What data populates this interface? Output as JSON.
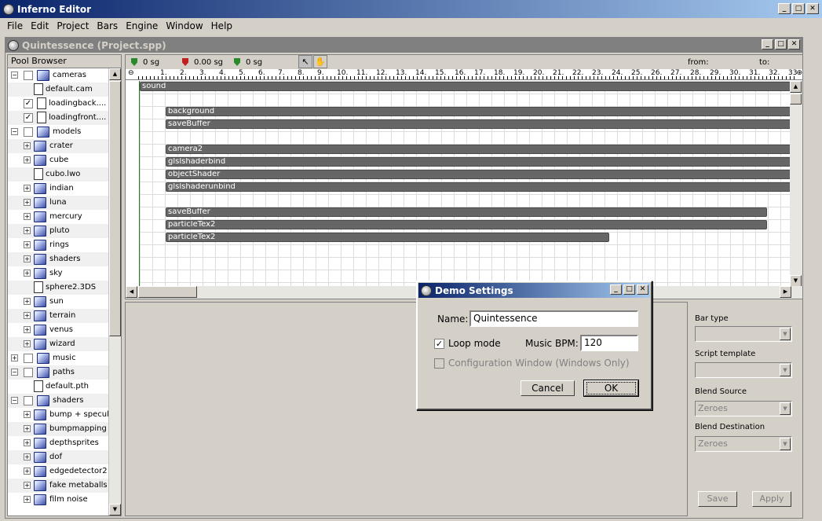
{
  "app": {
    "title": "Inferno Editor"
  },
  "menu": [
    "File",
    "Edit",
    "Project",
    "Bars",
    "Engine",
    "Window",
    "Help"
  ],
  "project_window": {
    "title": "Quintessence (Project.spp)"
  },
  "pool": {
    "header": "Pool Browser",
    "items": [
      {
        "label": "cameras",
        "type": "folder",
        "level": 0,
        "expander": "−",
        "checkbox": "unchecked"
      },
      {
        "label": "default.cam",
        "type": "file",
        "level": 1,
        "expander": "",
        "checkbox": "none"
      },
      {
        "label": "loadingback....",
        "type": "file",
        "level": 1,
        "expander": "",
        "checkbox": "checked"
      },
      {
        "label": "loadingfront....",
        "type": "file",
        "level": 1,
        "expander": "",
        "checkbox": "checked"
      },
      {
        "label": "models",
        "type": "folder",
        "level": 0,
        "expander": "−",
        "checkbox": "unchecked"
      },
      {
        "label": "crater",
        "type": "folder",
        "level": 1,
        "expander": "+",
        "checkbox": "none"
      },
      {
        "label": "cube",
        "type": "folder",
        "level": 1,
        "expander": "+",
        "checkbox": "none"
      },
      {
        "label": "cubo.lwo",
        "type": "file",
        "level": 1,
        "expander": "",
        "checkbox": "none"
      },
      {
        "label": "indian",
        "type": "folder",
        "level": 1,
        "expander": "+",
        "checkbox": "none"
      },
      {
        "label": "luna",
        "type": "folder",
        "level": 1,
        "expander": "+",
        "checkbox": "none"
      },
      {
        "label": "mercury",
        "type": "folder",
        "level": 1,
        "expander": "+",
        "checkbox": "none"
      },
      {
        "label": "pluto",
        "type": "folder",
        "level": 1,
        "expander": "+",
        "checkbox": "none"
      },
      {
        "label": "rings",
        "type": "folder",
        "level": 1,
        "expander": "+",
        "checkbox": "none"
      },
      {
        "label": "shaders",
        "type": "folder",
        "level": 1,
        "expander": "+",
        "checkbox": "none"
      },
      {
        "label": "sky",
        "type": "folder",
        "level": 1,
        "expander": "+",
        "checkbox": "none"
      },
      {
        "label": "sphere2.3DS",
        "type": "file",
        "level": 1,
        "expander": "",
        "checkbox": "none"
      },
      {
        "label": "sun",
        "type": "folder",
        "level": 1,
        "expander": "+",
        "checkbox": "none"
      },
      {
        "label": "terrain",
        "type": "folder",
        "level": 1,
        "expander": "+",
        "checkbox": "none"
      },
      {
        "label": "venus",
        "type": "folder",
        "level": 1,
        "expander": "+",
        "checkbox": "none"
      },
      {
        "label": "wizard",
        "type": "folder",
        "level": 1,
        "expander": "+",
        "checkbox": "none"
      },
      {
        "label": "music",
        "type": "folder",
        "level": 0,
        "expander": "+",
        "checkbox": "unchecked"
      },
      {
        "label": "paths",
        "type": "folder",
        "level": 0,
        "expander": "−",
        "checkbox": "unchecked"
      },
      {
        "label": "default.pth",
        "type": "file",
        "level": 1,
        "expander": "",
        "checkbox": "none"
      },
      {
        "label": "shaders",
        "type": "folder",
        "level": 0,
        "expander": "−",
        "checkbox": "unchecked"
      },
      {
        "label": "bump + specular",
        "type": "folder",
        "level": 1,
        "expander": "+",
        "checkbox": "none"
      },
      {
        "label": "bumpmapping",
        "type": "folder",
        "level": 1,
        "expander": "+",
        "checkbox": "none"
      },
      {
        "label": "depthsprites",
        "type": "folder",
        "level": 1,
        "expander": "+",
        "checkbox": "none"
      },
      {
        "label": "dof",
        "type": "folder",
        "level": 1,
        "expander": "+",
        "checkbox": "none"
      },
      {
        "label": "edgedetector2",
        "type": "folder",
        "level": 1,
        "expander": "+",
        "checkbox": "none"
      },
      {
        "label": "fake metaballs",
        "type": "folder",
        "level": 1,
        "expander": "+",
        "checkbox": "none"
      },
      {
        "label": "film noise",
        "type": "folder",
        "level": 1,
        "expander": "+",
        "checkbox": "none"
      }
    ]
  },
  "timeline": {
    "marker1": "0 sg",
    "marker2": "0.00 sg",
    "marker3": "0 sg",
    "from_label": "from:",
    "to_label": "to:",
    "ruler": [
      "1.",
      "2.",
      "3.",
      "4.",
      "5.",
      "6.",
      "7.",
      "8.",
      "9.",
      "10.",
      "11.",
      "12.",
      "13.",
      "14.",
      "15.",
      "16.",
      "17.",
      "18.",
      "19.",
      "20.",
      "21.",
      "22.",
      "23.",
      "24.",
      "25.",
      "26.",
      "27.",
      "28.",
      "29.",
      "30.",
      "31.",
      "32.",
      "33"
    ],
    "bars": [
      {
        "label": "sound",
        "row": 0,
        "start": 0,
        "end": 1
      },
      {
        "label": "background",
        "row": 2,
        "start": 0.04,
        "end": 1
      },
      {
        "label": "saveBuffer",
        "row": 3,
        "start": 0.04,
        "end": 1
      },
      {
        "label": "camera2",
        "row": 5,
        "start": 0.04,
        "end": 1
      },
      {
        "label": "glslshaderbind",
        "row": 6,
        "start": 0.04,
        "end": 1
      },
      {
        "label": "objectShader",
        "row": 7,
        "start": 0.04,
        "end": 1
      },
      {
        "label": "glslshaderunbind",
        "row": 8,
        "start": 0.04,
        "end": 1
      },
      {
        "label": "saveBuffer",
        "row": 10,
        "start": 0.04,
        "end": 0.961
      },
      {
        "label": "particleTex2",
        "row": 11,
        "start": 0.04,
        "end": 0.961
      },
      {
        "label": "particleTex2",
        "row": 12,
        "start": 0.04,
        "end": 0.719
      }
    ]
  },
  "properties": {
    "bar_type_label": "Bar type",
    "script_template_label": "Script template",
    "blend_source_label": "Blend Source",
    "blend_source_value": "Zeroes",
    "blend_destination_label": "Blend Destination",
    "blend_destination_value": "Zeroes",
    "save_label": "Save",
    "apply_label": "Apply"
  },
  "dialog": {
    "title": "Demo Settings",
    "name_label": "Name:",
    "name_value": "Quintessence",
    "loop_label": "Loop mode",
    "loop_checked": true,
    "bpm_label": "Music BPM:",
    "bpm_value": "120",
    "config_label": "Configuration Window (Windows Only)",
    "cancel_label": "Cancel",
    "ok_label": "OK"
  }
}
